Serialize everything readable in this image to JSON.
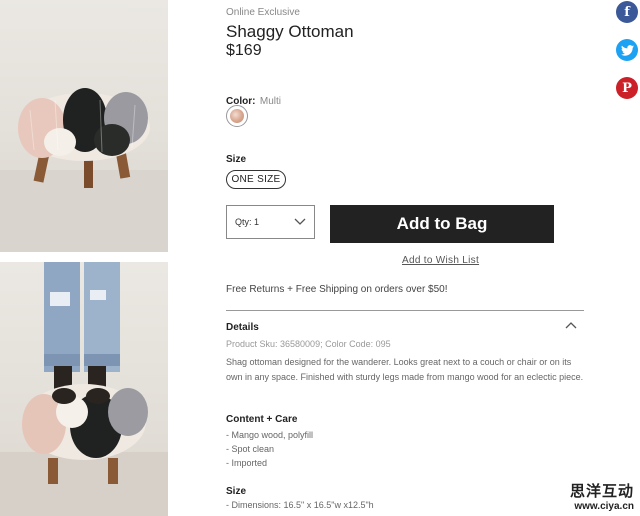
{
  "product": {
    "badge": "Online Exclusive",
    "title": "Shaggy Ottoman",
    "price": "$169"
  },
  "color": {
    "label": "Color:",
    "value": "Multi"
  },
  "size": {
    "label": "Size",
    "option": "ONE SIZE"
  },
  "qty": {
    "label": "Qty: 1",
    "chevron_icon": "chevron-down-icon"
  },
  "actions": {
    "add_to_bag": "Add to Bag",
    "wish_list": "Add to Wish List"
  },
  "shipping_note": "Free Returns + Free Shipping on orders over $50!",
  "details": {
    "heading": "Details",
    "sku_line": "Product Sku: 36580009; Color Code: 095",
    "description": "Shag ottoman designed for the wanderer. Looks great next to a couch or chair or on its own in any space. Finished with sturdy legs made from mango wood for an eclectic piece.",
    "content_heading": "Content + Care",
    "content_items": [
      "- Mango wood, polyfill",
      "- Spot clean",
      "- Imported"
    ],
    "size_heading": "Size",
    "size_items": [
      "- Dimensions: 16.5\" x 16.5\"w x12.5\"h"
    ],
    "collapse_icon": "chevron-up-icon"
  },
  "social": [
    {
      "name": "facebook-icon",
      "glyph": "f",
      "color": "#3b5998"
    },
    {
      "name": "twitter-icon",
      "glyph": "t",
      "color": "#1da1f2"
    },
    {
      "name": "pinterest-icon",
      "glyph": "P",
      "color": "#cb2027"
    }
  ],
  "watermark": {
    "line1": "思洋互动",
    "line2": "www.ciya.cn"
  }
}
